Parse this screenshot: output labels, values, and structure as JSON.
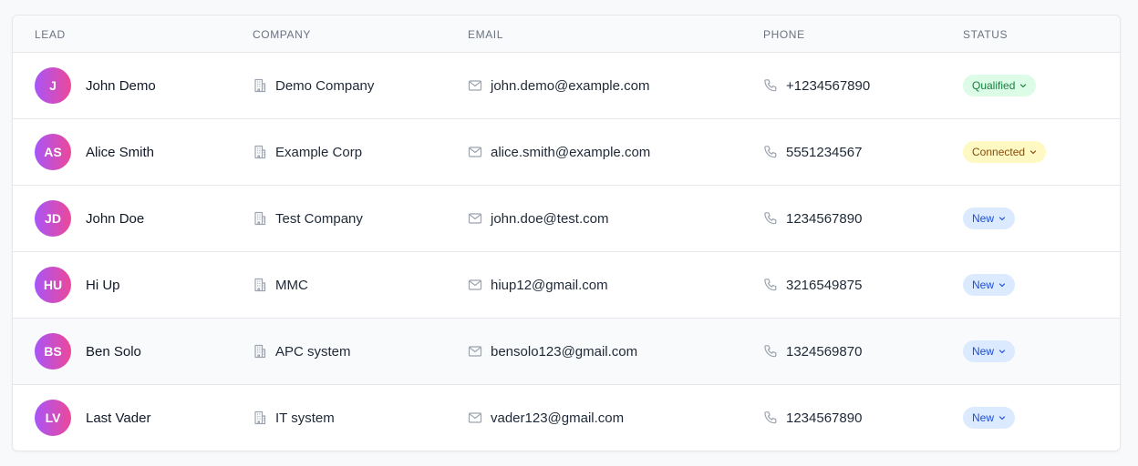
{
  "table": {
    "headers": {
      "lead": "LEAD",
      "company": "COMPANY",
      "email": "EMAIL",
      "phone": "PHONE",
      "status": "STATUS"
    },
    "rows": [
      {
        "initials": "J",
        "name": "John Demo",
        "company": "Demo Company",
        "email": "john.demo@example.com",
        "phone": "+1234567890",
        "status": "Qualified"
      },
      {
        "initials": "AS",
        "name": "Alice Smith",
        "company": "Example Corp",
        "email": "alice.smith@example.com",
        "phone": "5551234567",
        "status": "Connected"
      },
      {
        "initials": "JD",
        "name": "John Doe",
        "company": "Test Company",
        "email": "john.doe@test.com",
        "phone": "1234567890",
        "status": "New"
      },
      {
        "initials": "HU",
        "name": "Hi Up",
        "company": "MMC",
        "email": "hiup12@gmail.com",
        "phone": "3216549875",
        "status": "New"
      },
      {
        "initials": "BS",
        "name": "Ben Solo",
        "company": "APC system",
        "email": "bensolo123@gmail.com",
        "phone": "1324569870",
        "status": "New"
      },
      {
        "initials": "LV",
        "name": "Last Vader",
        "company": "IT system",
        "email": "vader123@gmail.com",
        "phone": "1234567890",
        "status": "New"
      }
    ]
  },
  "status_colors": {
    "Qualified": {
      "bg": "#dcfce7",
      "fg": "#15803d"
    },
    "Connected": {
      "bg": "#fef9c3",
      "fg": "#854d0e"
    },
    "New": {
      "bg": "#dbeafe",
      "fg": "#1d4ed8"
    }
  },
  "colors": {
    "avatar_gradient_start": "#a855f7",
    "avatar_gradient_end": "#ec4899",
    "icon_color": "#9ca3af"
  },
  "icons": {
    "company": "building-icon",
    "email": "mail-icon",
    "phone": "phone-icon",
    "status": "chevron-down-icon"
  }
}
